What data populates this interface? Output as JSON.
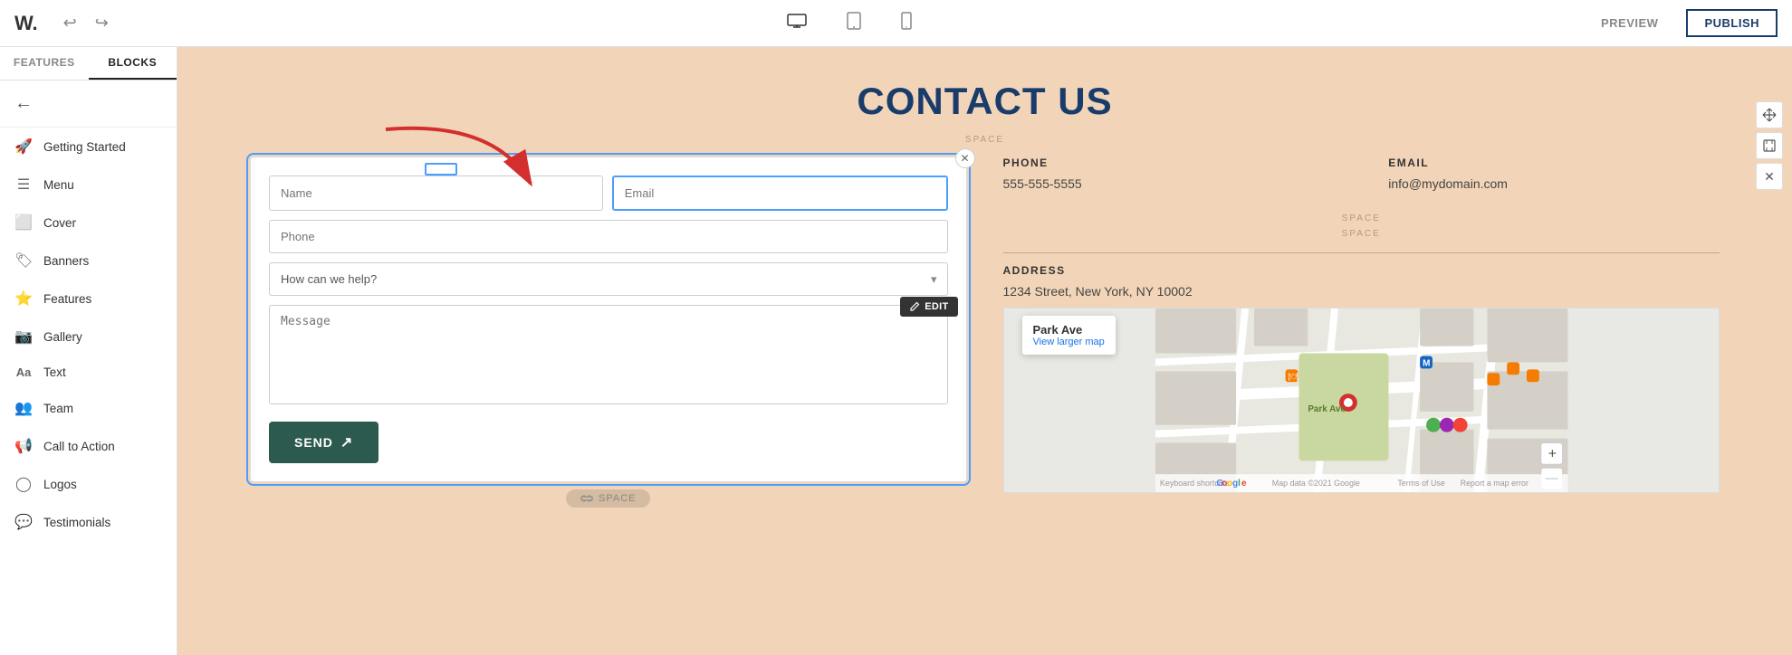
{
  "topbar": {
    "logo": "W.",
    "undo_label": "↩",
    "redo_label": "↪",
    "preview_label": "PREVIEW",
    "publish_label": "PUBLISH"
  },
  "sidebar": {
    "features_tab": "FEATURES",
    "blocks_tab": "BLOCKS",
    "items": [
      {
        "id": "getting-started",
        "icon": "🚀",
        "label": "Getting Started"
      },
      {
        "id": "menu",
        "icon": "☰",
        "label": "Menu"
      },
      {
        "id": "cover",
        "icon": "⬜",
        "label": "Cover"
      },
      {
        "id": "banners",
        "icon": "🏷",
        "label": "Banners"
      },
      {
        "id": "features",
        "icon": "⭐",
        "label": "Features"
      },
      {
        "id": "gallery",
        "icon": "📷",
        "label": "Gallery"
      },
      {
        "id": "text",
        "icon": "Aa",
        "label": "Text"
      },
      {
        "id": "team",
        "icon": "👥",
        "label": "Team"
      },
      {
        "id": "call-to-action",
        "icon": "📢",
        "label": "Call to Action"
      },
      {
        "id": "logos",
        "icon": "◯",
        "label": "Logos"
      },
      {
        "id": "testimonials",
        "icon": "💬",
        "label": "Testimonials"
      }
    ]
  },
  "canvas": {
    "page_title": "CONTACT US",
    "space_label": "SPACE",
    "form": {
      "name_placeholder": "Name",
      "email_placeholder": "Email",
      "phone_placeholder": "Phone",
      "how_placeholder": "How can we help?",
      "message_placeholder": "Message",
      "send_label": "SEND",
      "edit_label": "EDIT"
    },
    "contact_info": {
      "phone_label": "PHONE",
      "phone_value": "555-555-5555",
      "email_label": "EMAIL",
      "email_value": "info@mydomain.com",
      "address_label": "ADDRESS",
      "address_value": "1234 Street, New York, NY 10002"
    },
    "map": {
      "popup_title": "Park Ave",
      "popup_link": "View larger map"
    }
  }
}
